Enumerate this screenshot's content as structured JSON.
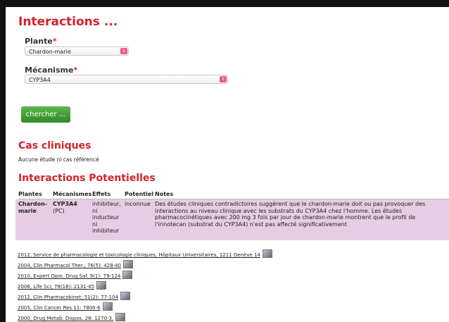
{
  "header": {
    "title": "Interactions ..."
  },
  "form": {
    "plante_label": "Plante",
    "plante_required": "*",
    "plante_value": "Chardon-marie",
    "mecanisme_label": "Mécanisme",
    "mecanisme_required": "*",
    "mecanisme_value": "CYP3A4",
    "search_button": "chercher ..."
  },
  "cas_cliniques": {
    "heading": "Cas cliniques",
    "text": "Aucune étude ni cas référencé"
  },
  "interactions": {
    "heading": "Interactions Potentielles",
    "columns": [
      "Plantes",
      "Mécanismes",
      "Effets",
      "Potentiel",
      "Notes"
    ],
    "row": {
      "plante": "Chardon-marie",
      "mecanisme": "CYP3A4",
      "mecanisme_sub": "(PC)",
      "effets": "inhibiteur, ni inducteur ni inhibiteur",
      "potentiel": "inconnue",
      "notes": "Des études cliniques contradictoires suggèrent que le chardon-marie doit ou pas provoquer des interactions au niveau clinique avec les substrats du CYP3A4 chez l'homme. Les études pharmacocinétiques avec 200 mg 3 fois par jour de chardon-marie montrent que le profil de l'irinotecan (substrat du CYP3A4) n'est pas affecté significativement"
    }
  },
  "references": [
    "2012, Service de pharmacologie et toxicologie cliniques, Hôpitaux Universitaires, 1211 Genève 14",
    "2004, Clin Pharmacol Ther.; 76(5): 428-40",
    "2010, Expert Opin. Drug Saf. 9(1): 79-124",
    "2006, Life Sci; 78(18): 2131-45",
    "2012, Clin Pharmacokinet; 51(2): 77-104",
    "2005, Clin Cancer Res 11: 7800-6",
    "2000, Drug Metab. Dispos. 28: 1270-3."
  ],
  "icons": {
    "reference_thumbnail": "image-thumbnail-icon",
    "select_arrow": "select-arrow-icon"
  },
  "colors": {
    "accent_red": "#d2232a",
    "button_green": "#3a9a2f",
    "row_highlight": "#e6cde3",
    "select_arrow": "#e85c7f"
  }
}
